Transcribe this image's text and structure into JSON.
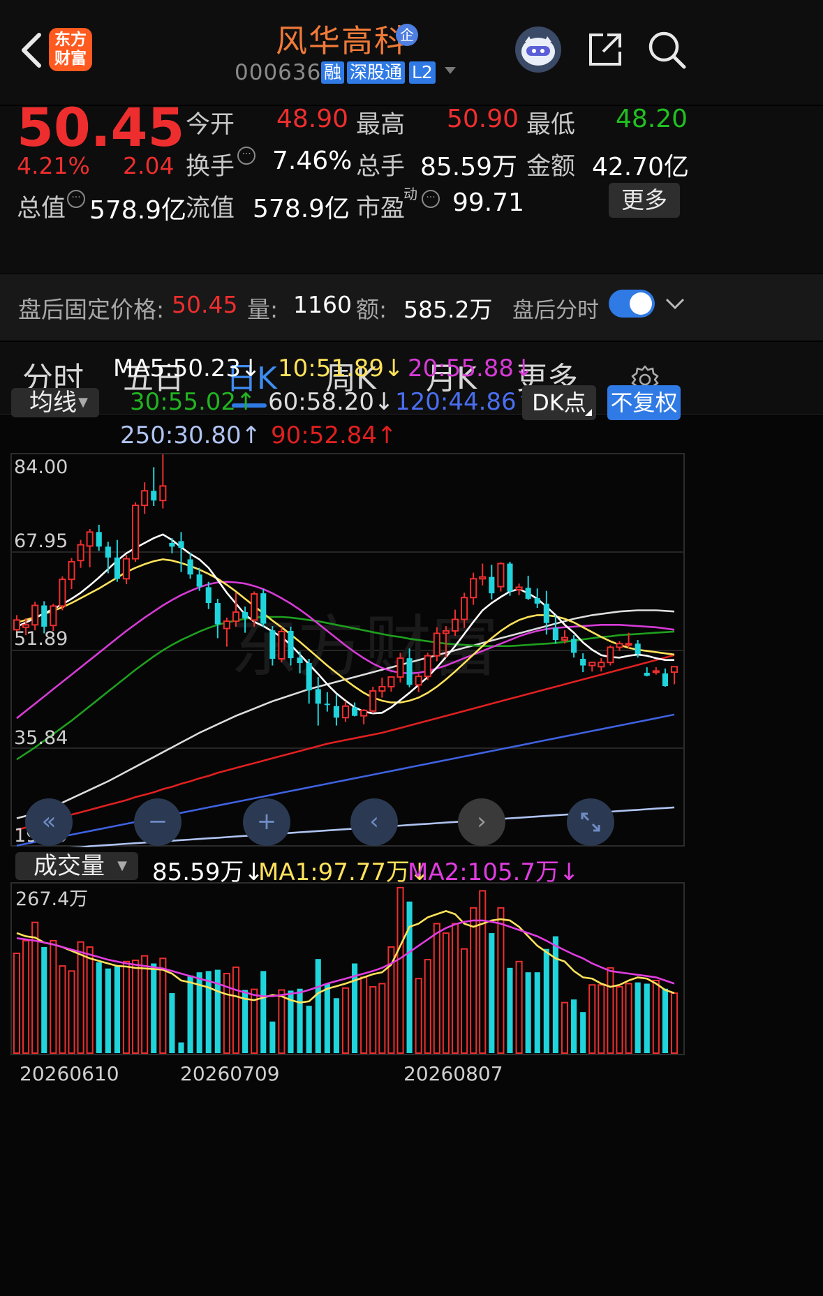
{
  "header": {
    "stock_name": "风华高科",
    "badge_enterprise": "企",
    "stock_code": "000636",
    "tags": [
      "融",
      "深股通",
      "L2"
    ],
    "logo_text": [
      "东方",
      "财富"
    ]
  },
  "quote": {
    "price": "50.45",
    "change_pct": "4.21%",
    "change_amt": "2.04",
    "fields": {
      "open_label": "今开",
      "open": "48.90",
      "high_label": "最高",
      "high": "50.90",
      "low_label": "最低",
      "low": "48.20",
      "turnover_label": "换手",
      "turnover": "7.46%",
      "volume_label": "总手",
      "volume": "85.59万",
      "amount_label": "金额",
      "amount": "42.70亿",
      "mktcap_label": "总值",
      "mktcap": "578.9亿",
      "float_label": "流值",
      "float": "578.9亿",
      "pe_label": "市盈",
      "pe_sup": "动",
      "pe": "99.71"
    },
    "more_label": "更多"
  },
  "after_hours": {
    "price_label": "盘后固定价格:",
    "price": "50.45",
    "vol_label": "量:",
    "vol": "1160",
    "amt_label": "额:",
    "amt": "585.2万",
    "toggle_label": "盘后分时",
    "toggle_on": true
  },
  "tabs": [
    {
      "label": "分时",
      "active": false
    },
    {
      "label": "五日",
      "active": false
    },
    {
      "label": "日K",
      "active": true
    },
    {
      "label": "周K",
      "active": false
    },
    {
      "label": "月K",
      "active": false
    },
    {
      "label": "更多",
      "active": false
    }
  ],
  "ma_legend": {
    "dropdown": "均线",
    "ma5": "MA5:50.23↓",
    "ma10": "10:51.89↓",
    "ma20": "20:55.88↓",
    "ma30": "30:55.02↑",
    "ma60": "60:58.20↓",
    "ma120": "120:44.86↑",
    "ma250": "250:30.80↑",
    "ma90": "90:52.84↑",
    "dk_button": "DK点",
    "adjust_button": "不复权"
  },
  "colors": {
    "up": "#ee2e2e",
    "down": "#20d4dc",
    "ma5": "#ffffff",
    "ma10": "#ffe25a",
    "ma20": "#d63bd6",
    "ma30": "#1ea01e",
    "ma60": "#dddddd",
    "ma90": "#e02020",
    "ma120": "#3f62e0",
    "ma250": "#b0c4f2",
    "accent": "#2f7ae5"
  },
  "price_axis": [
    "84.00",
    "67.95",
    "51.89",
    "35.84",
    "19.79"
  ],
  "volume_legend": {
    "dropdown": "成交量",
    "vol": "85.59万↓",
    "ma1": "MA1:97.77万↓",
    "ma2": "MA2:105.7万↓",
    "axis_max": "267.4万"
  },
  "date_axis": [
    "20260610",
    "20260709",
    "20260807"
  ],
  "watermark": "东方财富",
  "chart_data": {
    "type": "candlestick",
    "ylim": [
      19.79,
      84.0
    ],
    "candles": [
      [
        55.2,
        57.6,
        53.9,
        56.8
      ],
      [
        55.6,
        57.1,
        54.3,
        56.0
      ],
      [
        56.0,
        59.8,
        55.1,
        59.2
      ],
      [
        59.2,
        59.9,
        54.6,
        55.7
      ],
      [
        55.9,
        59.5,
        55.0,
        59.1
      ],
      [
        59.1,
        64.0,
        58.4,
        63.5
      ],
      [
        63.5,
        67.0,
        61.9,
        66.4
      ],
      [
        66.6,
        70.0,
        65.4,
        69.2
      ],
      [
        69.0,
        71.8,
        65.5,
        71.3
      ],
      [
        71.3,
        72.5,
        68.2,
        68.9
      ],
      [
        68.9,
        69.7,
        64.5,
        67.1
      ],
      [
        67.1,
        70.0,
        63.1,
        63.6
      ],
      [
        63.6,
        67.5,
        62.7,
        66.9
      ],
      [
        66.9,
        76.2,
        66.4,
        75.7
      ],
      [
        75.7,
        79.5,
        74.3,
        78.1
      ],
      [
        78.1,
        82.0,
        75.6,
        76.5
      ],
      [
        76.5,
        84.1,
        75.2,
        78.9
      ],
      [
        69.5,
        70.3,
        67.8,
        68.9
      ],
      [
        69.8,
        71.3,
        64.7,
        68.7
      ],
      [
        66.8,
        67.9,
        63.6,
        64.3
      ],
      [
        64.3,
        65.4,
        61.6,
        62.3
      ],
      [
        62.2,
        63.1,
        58.6,
        59.6
      ],
      [
        59.6,
        60.3,
        53.8,
        56.1
      ],
      [
        55.4,
        57.2,
        52.4,
        56.6
      ],
      [
        56.6,
        61.3,
        55.7,
        58.1
      ],
      [
        58.1,
        59.0,
        54.7,
        57.1
      ],
      [
        56.8,
        61.5,
        55.7,
        61.1
      ],
      [
        61.2,
        61.9,
        55.7,
        56.2
      ],
      [
        55.1,
        55.8,
        49.3,
        50.4
      ],
      [
        50.4,
        55.6,
        49.8,
        54.9
      ],
      [
        55.0,
        55.7,
        49.3,
        50.5
      ],
      [
        50.6,
        51.6,
        48.0,
        49.7
      ],
      [
        49.7,
        50.4,
        43.0,
        45.2
      ],
      [
        45.4,
        47.4,
        39.4,
        43.0
      ],
      [
        43.0,
        44.9,
        41.7,
        42.8
      ],
      [
        42.6,
        44.5,
        39.4,
        40.7
      ],
      [
        40.7,
        43.4,
        40.0,
        42.6
      ],
      [
        42.4,
        43.2,
        40.9,
        41.0
      ],
      [
        41.0,
        42.1,
        39.6,
        41.9
      ],
      [
        41.8,
        45.8,
        41.4,
        45.1
      ],
      [
        45.1,
        47.3,
        44.0,
        45.8
      ],
      [
        45.8,
        47.5,
        45.0,
        47.4
      ],
      [
        47.4,
        51.4,
        46.5,
        50.5
      ],
      [
        50.5,
        52.1,
        45.7,
        46.1
      ],
      [
        46.1,
        47.9,
        44.9,
        47.5
      ],
      [
        47.5,
        51.4,
        46.9,
        50.9
      ],
      [
        50.9,
        55.6,
        50.0,
        54.6
      ],
      [
        54.6,
        55.8,
        50.6,
        55.0
      ],
      [
        55.0,
        58.5,
        54.2,
        56.9
      ],
      [
        56.9,
        61.3,
        55.5,
        60.5
      ],
      [
        60.5,
        64.6,
        59.3,
        63.6
      ],
      [
        63.6,
        66.1,
        62.5,
        63.9
      ],
      [
        63.9,
        65.9,
        60.2,
        61.2
      ],
      [
        62.3,
        66.3,
        61.5,
        66.1
      ],
      [
        66.1,
        66.4,
        60.8,
        61.5
      ],
      [
        61.8,
        62.8,
        60.9,
        62.2
      ],
      [
        62.1,
        64.1,
        60.1,
        60.3
      ],
      [
        60.4,
        62.0,
        58.8,
        59.5
      ],
      [
        59.5,
        61.6,
        54.4,
        56.3
      ],
      [
        55.5,
        57.6,
        52.9,
        53.5
      ],
      [
        53.5,
        55.1,
        52.9,
        53.9
      ],
      [
        53.7,
        54.3,
        50.6,
        51.4
      ],
      [
        50.4,
        51.3,
        48.2,
        49.3
      ],
      [
        49.3,
        49.9,
        48.3,
        49.8
      ],
      [
        49.1,
        50.5,
        48.3,
        49.8
      ],
      [
        49.8,
        52.6,
        49.3,
        52.3
      ],
      [
        52.3,
        53.3,
        51.7,
        52.9
      ],
      [
        52.8,
        54.7,
        52.1,
        52.9
      ],
      [
        52.9,
        53.5,
        50.6,
        51.2
      ],
      [
        48.1,
        49.0,
        47.5,
        47.6
      ],
      [
        48.3,
        49.0,
        47.8,
        48.4
      ],
      [
        48.0,
        48.8,
        45.8,
        45.9
      ],
      [
        48.2,
        49.0,
        46.2,
        49.1
      ]
    ],
    "ma5": [
      55.7,
      56.4,
      57.1,
      57.9,
      58.6,
      59.4,
      60.3,
      61.3,
      62.5,
      63.8,
      65.2,
      66.6,
      67.8,
      68.7,
      69.5,
      70.3,
      70.9,
      70.0,
      68.8,
      67.7,
      66.8,
      65.4,
      63.4,
      61.3,
      59.5,
      57.7,
      56.5,
      55.8,
      54.9,
      54.0,
      52.7,
      51.1,
      49.5,
      47.9,
      46.2,
      44.7,
      43.5,
      42.4,
      41.7,
      41.4,
      41.5,
      42.4,
      43.6,
      44.8,
      46.1,
      47.4,
      49.0,
      50.7,
      52.5,
      54.5,
      56.5,
      58.4,
      59.6,
      60.6,
      61.5,
      61.9,
      61.2,
      60.3,
      59.0,
      57.6,
      56.0,
      54.7,
      53.1,
      51.9,
      51.0,
      50.7,
      50.6,
      50.9,
      51.1,
      50.9,
      50.5,
      50.2,
      50.2
    ],
    "ma10": [
      56.4,
      56.8,
      57.3,
      57.8,
      58.3,
      58.9,
      59.6,
      60.4,
      61.2,
      62.0,
      62.9,
      63.8,
      64.7,
      65.4,
      66.0,
      66.5,
      66.8,
      66.6,
      66.2,
      65.7,
      65.1,
      64.4,
      63.6,
      62.6,
      61.5,
      60.3,
      59.1,
      57.9,
      56.7,
      55.6,
      54.4,
      53.2,
      51.9,
      50.6,
      49.3,
      48.1,
      46.9,
      45.8,
      44.8,
      44.0,
      43.5,
      43.2,
      43.2,
      43.5,
      44.0,
      44.8,
      45.8,
      47.0,
      48.3,
      49.7,
      51.1,
      52.5,
      53.8,
      55.0,
      56.0,
      56.8,
      57.3,
      57.6,
      57.6,
      57.4,
      57.0,
      56.4,
      55.6,
      54.8,
      54.0,
      53.3,
      52.7,
      52.2,
      51.9,
      51.7,
      51.5,
      51.3,
      51.1
    ],
    "ma20": [
      40.6,
      41.8,
      43.0,
      44.2,
      45.4,
      46.6,
      47.8,
      49.0,
      50.2,
      51.4,
      52.6,
      53.8,
      55.0,
      56.1,
      57.2,
      58.2,
      59.2,
      60.1,
      60.9,
      61.6,
      62.2,
      62.7,
      63.0,
      63.1,
      63.0,
      62.8,
      62.4,
      61.9,
      61.2,
      60.4,
      59.5,
      58.5,
      57.4,
      56.2,
      55.0,
      53.8,
      52.6,
      51.5,
      50.5,
      49.6,
      48.9,
      48.4,
      48.1,
      48.0,
      48.1,
      48.4,
      48.8,
      49.3,
      49.9,
      50.5,
      51.1,
      51.7,
      52.3,
      52.9,
      53.5,
      54.1,
      54.6,
      55.0,
      55.3,
      55.5,
      55.6,
      55.7,
      55.8,
      55.9,
      56.0,
      56.0,
      56.0,
      55.9,
      55.8,
      55.7,
      55.6,
      55.4,
      55.2
    ],
    "ma30": [
      33.8,
      34.8,
      35.8,
      36.9,
      38.0,
      39.1,
      40.2,
      41.4,
      42.6,
      43.8,
      45.0,
      46.2,
      47.4,
      48.6,
      49.7,
      50.8,
      51.8,
      52.7,
      53.5,
      54.2,
      54.9,
      55.5,
      56.0,
      56.4,
      56.7,
      57.0,
      57.2,
      57.3,
      57.3,
      57.3,
      57.2,
      57.0,
      56.8,
      56.6,
      56.3,
      56.0,
      55.7,
      55.4,
      55.1,
      54.8,
      54.5,
      54.2,
      54.0,
      53.7,
      53.5,
      53.3,
      53.1,
      52.9,
      52.8,
      52.7,
      52.6,
      52.5,
      52.5,
      52.5,
      52.5,
      52.6,
      52.7,
      52.8,
      52.9,
      53.0,
      53.2,
      53.4,
      53.6,
      53.8,
      54.0,
      54.1,
      54.3,
      54.4,
      54.5,
      54.6,
      54.7,
      54.8,
      54.9
    ],
    "ma60": [
      24.1,
      24.5,
      25.0,
      25.5,
      26.1,
      26.7,
      27.4,
      28.1,
      28.8,
      29.5,
      30.2,
      31.0,
      31.8,
      32.6,
      33.4,
      34.2,
      35.0,
      35.8,
      36.6,
      37.4,
      38.2,
      38.9,
      39.6,
      40.3,
      41.0,
      41.6,
      42.2,
      42.8,
      43.4,
      43.9,
      44.4,
      44.9,
      45.4,
      45.8,
      46.2,
      46.6,
      47.0,
      47.4,
      47.8,
      48.2,
      48.6,
      49.0,
      49.4,
      49.8,
      50.2,
      50.6,
      51.0,
      51.4,
      51.8,
      52.2,
      52.6,
      53.0,
      53.4,
      53.8,
      54.2,
      54.6,
      55.0,
      55.4,
      55.8,
      56.2,
      56.6,
      57.0,
      57.3,
      57.6,
      57.8,
      58.0,
      58.2,
      58.3,
      58.4,
      58.4,
      58.4,
      58.3,
      58.2
    ],
    "ma90": [
      22.2,
      22.6,
      23.1,
      23.5,
      23.9,
      24.3,
      24.7,
      25.1,
      25.5,
      25.9,
      26.3,
      26.7,
      27.1,
      27.6,
      28.0,
      28.4,
      28.9,
      29.3,
      29.8,
      30.2,
      30.7,
      31.1,
      31.6,
      32.0,
      32.4,
      32.8,
      33.2,
      33.6,
      34.0,
      34.4,
      34.8,
      35.2,
      35.6,
      36.0,
      36.4,
      36.7,
      37.0,
      37.3,
      37.6,
      37.9,
      38.2,
      38.6,
      39.0,
      39.4,
      39.8,
      40.2,
      40.6,
      41.0,
      41.4,
      41.8,
      42.2,
      42.6,
      43.0,
      43.4,
      43.8,
      44.2,
      44.6,
      45.0,
      45.4,
      45.8,
      46.2,
      46.6,
      47.0,
      47.4,
      47.8,
      48.2,
      48.6,
      49.0,
      49.4,
      49.8,
      50.2,
      50.6,
      51.0
    ],
    "ma120": [
      19.6,
      19.9,
      20.2,
      20.5,
      20.8,
      21.1,
      21.4,
      21.7,
      22.0,
      22.3,
      22.6,
      22.9,
      23.2,
      23.5,
      23.8,
      24.1,
      24.4,
      24.7,
      25.0,
      25.3,
      25.6,
      25.9,
      26.2,
      26.5,
      26.8,
      27.1,
      27.4,
      27.7,
      28.0,
      28.3,
      28.6,
      28.9,
      29.2,
      29.5,
      29.8,
      30.1,
      30.4,
      30.7,
      31.0,
      31.3,
      31.6,
      31.9,
      32.2,
      32.5,
      32.8,
      33.1,
      33.4,
      33.7,
      34.0,
      34.3,
      34.6,
      34.9,
      35.2,
      35.5,
      35.8,
      36.1,
      36.4,
      36.7,
      37.0,
      37.3,
      37.6,
      37.9,
      38.2,
      38.5,
      38.8,
      39.1,
      39.4,
      39.7,
      40.0,
      40.3,
      40.6,
      40.9,
      41.2
    ],
    "ma250": [
      18.6,
      18.7,
      18.8,
      18.9,
      19.0,
      19.1,
      19.2,
      19.3,
      19.5,
      19.6,
      19.7,
      19.8,
      19.9,
      20.0,
      20.1,
      20.2,
      20.3,
      20.4,
      20.5,
      20.6,
      20.7,
      20.8,
      20.9,
      21.0,
      21.1,
      21.2,
      21.3,
      21.4,
      21.5,
      21.6,
      21.7,
      21.8,
      21.9,
      22.0,
      22.1,
      22.2,
      22.3,
      22.4,
      22.5,
      22.6,
      22.7,
      22.8,
      22.9,
      23.0,
      23.1,
      23.2,
      23.3,
      23.4,
      23.5,
      23.6,
      23.7,
      23.8,
      23.9,
      24.0,
      24.1,
      24.2,
      24.3,
      24.4,
      24.5,
      24.6,
      24.7,
      24.8,
      24.9,
      25.0,
      25.1,
      25.2,
      25.3,
      25.4,
      25.5,
      25.6,
      25.7,
      25.8,
      25.9
    ],
    "volume": [
      158,
      178,
      207,
      168,
      178,
      138,
      130,
      176,
      168,
      144,
      134,
      138,
      145,
      147,
      154,
      142,
      150,
      95,
      17,
      123,
      128,
      130,
      132,
      126,
      136,
      100,
      101,
      130,
      50,
      100,
      99,
      102,
      75,
      149,
      110,
      87,
      103,
      142,
      120,
      105,
      110,
      168,
      262,
      240,
      118,
      148,
      205,
      190,
      205,
      165,
      230,
      257,
      190,
      230,
      135,
      145,
      128,
      128,
      165,
      185,
      80,
      85,
      65,
      108,
      108,
      135,
      105,
      110,
      112,
      110,
      115,
      102,
      95
    ],
    "ma1": [
      190,
      185,
      183,
      175,
      172,
      168,
      162,
      156,
      150,
      146,
      142,
      138,
      137,
      135,
      134,
      133,
      132,
      126,
      115,
      112,
      108,
      104,
      98,
      93,
      90,
      86,
      84,
      88,
      92,
      90,
      84,
      80,
      82,
      95,
      102,
      106,
      110,
      115,
      120,
      125,
      128,
      140,
      170,
      200,
      205,
      215,
      220,
      225,
      220,
      205,
      200,
      205,
      210,
      212,
      210,
      200,
      185,
      170,
      160,
      150,
      145,
      130,
      120,
      118,
      110,
      105,
      108,
      115,
      120,
      118,
      110,
      100,
      95
    ],
    "ma2": [
      182,
      180,
      178,
      175,
      172,
      168,
      164,
      160,
      156,
      152,
      148,
      145,
      142,
      140,
      138,
      136,
      134,
      130,
      126,
      122,
      118,
      114,
      110,
      105,
      100,
      96,
      92,
      90,
      90,
      92,
      94,
      96,
      100,
      105,
      110,
      114,
      118,
      122,
      126,
      130,
      135,
      142,
      150,
      160,
      170,
      180,
      190,
      198,
      204,
      208,
      210,
      210,
      208,
      205,
      200,
      195,
      190,
      185,
      178,
      170,
      163,
      156,
      150,
      142,
      136,
      130,
      128,
      126,
      124,
      122,
      120,
      115,
      110
    ]
  }
}
